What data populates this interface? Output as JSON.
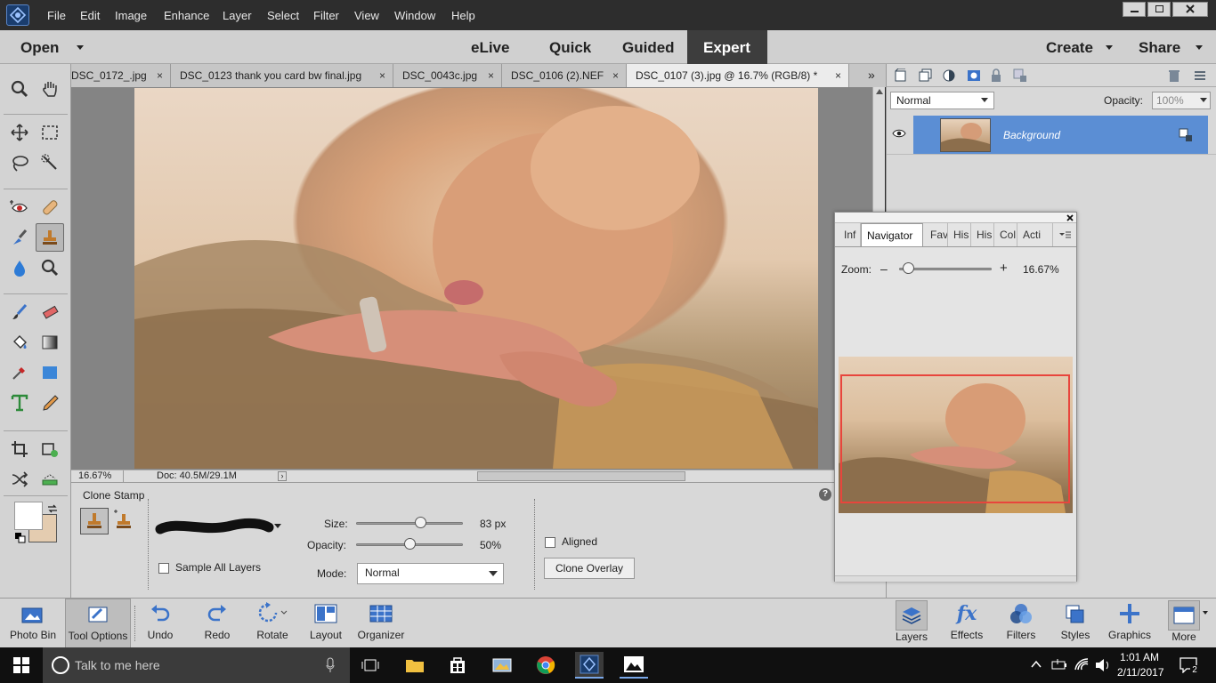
{
  "menu": [
    "File",
    "Edit",
    "Image",
    "Enhance",
    "Layer",
    "Select",
    "Filter",
    "View",
    "Window",
    "Help"
  ],
  "modebar": {
    "open": "Open",
    "elive": "eLive",
    "quick": "Quick",
    "guided": "Guided",
    "expert": "Expert",
    "create": "Create",
    "share": "Share"
  },
  "doc_tabs": [
    {
      "label": "DSC_0172_.jpg"
    },
    {
      "label": "DSC_0123 thank you card bw final.jpg"
    },
    {
      "label": "DSC_0043c.jpg"
    },
    {
      "label": "DSC_0106 (2).NEF"
    },
    {
      "label": "DSC_0107 (3).jpg @ 16.7% (RGB/8) *"
    }
  ],
  "tab_close": "×",
  "tab_overflow": "»",
  "status": {
    "zoom": "16.67%",
    "doc": "Doc: 40.5M/29.1M"
  },
  "tool_options": {
    "title": "Clone Stamp",
    "size_label": "Size:",
    "size_value": "83 px",
    "size_level": 0.6,
    "opacity_label": "Opacity:",
    "opacity_value": "50%",
    "opacity_level": 0.5,
    "mode_label": "Mode:",
    "mode_value": "Normal",
    "sample_all": "Sample All Layers",
    "aligned": "Aligned",
    "clone_overlay": "Clone Overlay",
    "help": "?"
  },
  "layers": {
    "blend_mode": "Normal",
    "opacity_label": "Opacity:",
    "opacity_value": "100%",
    "layer_name": "Background"
  },
  "navigator": {
    "tabs": [
      "Inf",
      "Navigator",
      "Fav",
      "His",
      "His",
      "Col",
      "Acti"
    ],
    "zoom_label": "Zoom:",
    "zoom_value": "16.67%",
    "zoom_level": 0.1,
    "minus": "–",
    "plus": "+"
  },
  "bottombar": {
    "left": [
      "Photo Bin",
      "Tool Options",
      "Undo",
      "Redo",
      "Rotate",
      "Layout",
      "Organizer"
    ],
    "right": [
      "Layers",
      "Effects",
      "Filters",
      "Styles",
      "Graphics",
      "More"
    ]
  },
  "taskbar": {
    "search": "Talk to me here",
    "time": "1:01 AM",
    "date": "2/11/2017",
    "notif": "2"
  },
  "colors": {
    "accent": "#5b8ed4",
    "selected_layer": "#5b8ed4",
    "nav_box": "#e8453c",
    "bg_swatch": "#e4ccb0"
  }
}
